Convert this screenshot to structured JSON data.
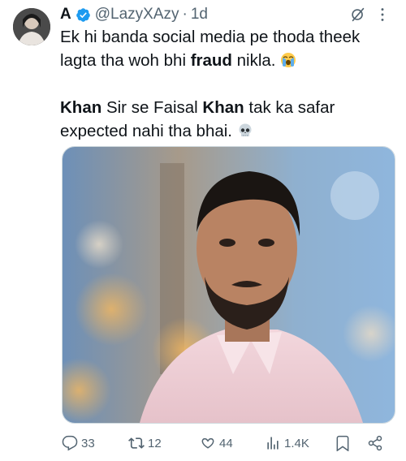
{
  "author": {
    "name": "A",
    "handle": "@LazyXAzy",
    "separator": "·",
    "time": "1d"
  },
  "tweet": {
    "line1_pre": "Ek hi banda social media pe thoda theek lagta tha woh bhi ",
    "line1_bold": "fraud",
    "line1_post": " nikla.",
    "line1_emoji": "loudly-crying-face-emoji",
    "line2_bold1": "Khan",
    "line2_mid": " Sir se Faisal ",
    "line2_bold2": "Khan",
    "line2_post": " tak ka safar expected nahi tha bhai.",
    "line2_emoji": "skull-emoji"
  },
  "actions": {
    "replies": "33",
    "reposts": "12",
    "likes": "44",
    "views": "1.4K"
  },
  "colors": {
    "text": "#0f1419",
    "secondary": "#536471",
    "verified": "#1d9bf0"
  }
}
